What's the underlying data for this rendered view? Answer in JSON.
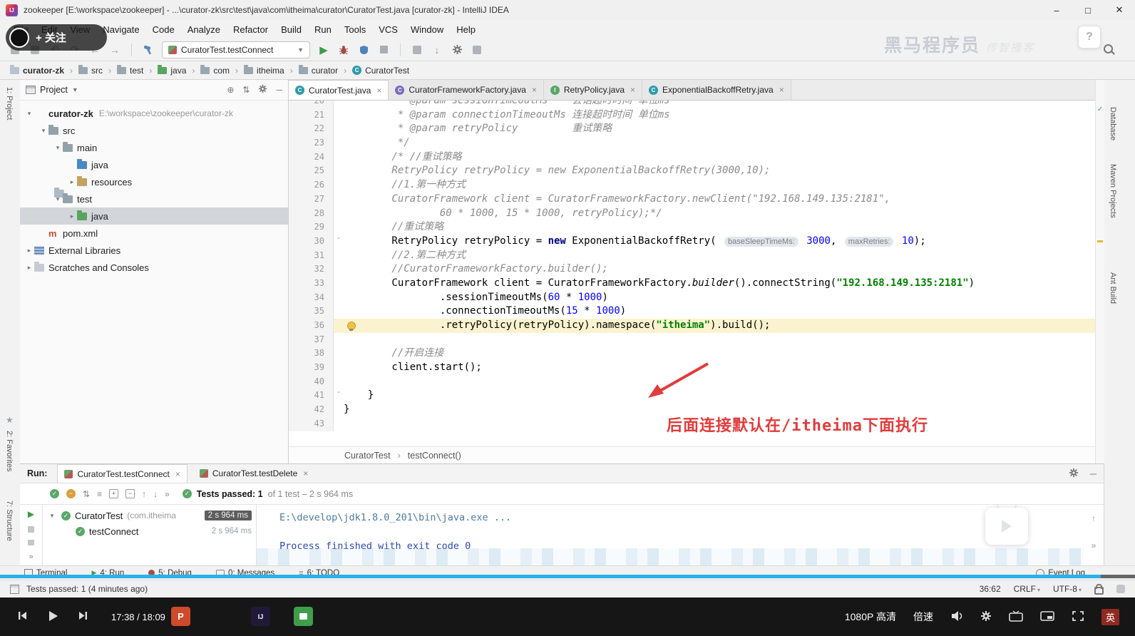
{
  "window": {
    "title": "zookeeper [E:\\workspace\\zookeeper] - ...\\curator-zk\\src\\test\\java\\com\\itheima\\curator\\CuratorTest.java [curator-zk] - IntelliJ IDEA",
    "minimize": "–",
    "maximize": "□",
    "close": "✕"
  },
  "menu": {
    "items": [
      "File",
      "Edit",
      "View",
      "Navigate",
      "Code",
      "Analyze",
      "Refactor",
      "Build",
      "Run",
      "Tools",
      "VCS",
      "Window",
      "Help"
    ]
  },
  "overlay": {
    "follow": "+ 关注",
    "watermark": "黑马程序员",
    "watermark_sub": "传智播客",
    "help": "?"
  },
  "toolbar": {
    "run_config": "CuratorTest.testConnect"
  },
  "breadcrumbs": {
    "items": [
      {
        "label": "curator-zk",
        "icon": "module",
        "bold": true
      },
      {
        "label": "src",
        "icon": "folder"
      },
      {
        "label": "test",
        "icon": "folder"
      },
      {
        "label": "java",
        "icon": "folder-green"
      },
      {
        "label": "com",
        "icon": "folder"
      },
      {
        "label": "itheima",
        "icon": "folder"
      },
      {
        "label": "curator",
        "icon": "folder"
      },
      {
        "label": "CuratorTest",
        "icon": "class"
      }
    ]
  },
  "stripes": {
    "left": [
      "1: Project",
      "2: Favorites",
      "7: Structure"
    ],
    "right": [
      "Database",
      "Maven Projects",
      "Ant Build"
    ]
  },
  "project_panel": {
    "header": "Project",
    "tree": [
      {
        "label": "curator-zk",
        "extra": "E:\\workspace\\zookeeper\\curator-zk",
        "depth": 0,
        "caret": "v",
        "icon": "project",
        "bold": true
      },
      {
        "label": "src",
        "depth": 1,
        "caret": "v",
        "icon": "folder"
      },
      {
        "label": "main",
        "depth": 2,
        "caret": "v",
        "icon": "folder"
      },
      {
        "label": "java",
        "depth": 3,
        "caret": "",
        "icon": "folder-blue"
      },
      {
        "label": "resources",
        "depth": 3,
        "caret": ">",
        "icon": "folder-res"
      },
      {
        "label": "test",
        "depth": 2,
        "caret": "v",
        "icon": "folder"
      },
      {
        "label": "java",
        "depth": 3,
        "caret": ">",
        "icon": "folder-green",
        "selected": true
      },
      {
        "label": "pom.xml",
        "depth": 1,
        "caret": "",
        "icon": "maven"
      },
      {
        "label": "External Libraries",
        "depth": 0,
        "caret": ">",
        "icon": "libs"
      },
      {
        "label": "Scratches and Consoles",
        "depth": 0,
        "caret": ">",
        "icon": "scratch"
      }
    ]
  },
  "editor": {
    "tabs": [
      {
        "label": "CuratorTest.java",
        "icon": "C",
        "color": "#2e9bab",
        "active": true
      },
      {
        "label": "CuratorFrameworkFactory.java",
        "icon": "C",
        "color": "#7d6cc0"
      },
      {
        "label": "RetryPolicy.java",
        "icon": "I",
        "color": "#59a869"
      },
      {
        "label": "ExponentialBackoffRetry.java",
        "icon": "C",
        "color": "#2e9bab"
      }
    ],
    "breadcrumb_bottom": {
      "class": "CuratorTest",
      "method": "testConnect()"
    },
    "annotation": "后面连接默认在/itheima下面执行",
    "lines": [
      {
        "n": 20,
        "segs": [
          [
            "c",
            "         * @param sessionTimeoutMs    会话超时时间 单位ms"
          ]
        ]
      },
      {
        "n": 21,
        "segs": [
          [
            "c",
            "         * @param connectionTimeoutMs 连接超时时间 单位ms"
          ]
        ]
      },
      {
        "n": 22,
        "segs": [
          [
            "c",
            "         * @param retryPolicy         重试策略"
          ]
        ]
      },
      {
        "n": 23,
        "segs": [
          [
            "c",
            "         */"
          ]
        ]
      },
      {
        "n": 24,
        "segs": [
          [
            "c",
            "        /* //重试策略"
          ]
        ]
      },
      {
        "n": 25,
        "segs": [
          [
            "c",
            "        RetryPolicy retryPolicy = new ExponentialBackoffRetry(3000,10);"
          ]
        ]
      },
      {
        "n": 26,
        "segs": [
          [
            "c",
            "        //1.第一种方式"
          ]
        ]
      },
      {
        "n": 27,
        "segs": [
          [
            "c",
            "        CuratorFramework client = CuratorFrameworkFactory.newClient(\"192.168.149.135:2181\","
          ]
        ]
      },
      {
        "n": 28,
        "segs": [
          [
            "c",
            "                60 * 1000, 15 * 1000, retryPolicy);*/"
          ]
        ]
      },
      {
        "n": 29,
        "segs": [
          [
            "c",
            "        //重试策略"
          ]
        ]
      },
      {
        "n": 30,
        "fold": "v",
        "segs": [
          [
            "p",
            "        RetryPolicy retryPolicy = "
          ],
          [
            "k",
            "new"
          ],
          [
            "p",
            " ExponentialBackoffRetry( "
          ],
          [
            "h",
            "baseSleepTimeMs:"
          ],
          [
            "n",
            " 3000"
          ],
          [
            "p",
            ", "
          ],
          [
            "h",
            "maxRetries:"
          ],
          [
            "n",
            " 10"
          ],
          [
            "p",
            ");"
          ]
        ]
      },
      {
        "n": 31,
        "segs": [
          [
            "c",
            "        //2.第二种方式"
          ]
        ]
      },
      {
        "n": 32,
        "segs": [
          [
            "c",
            "        //CuratorFrameworkFactory.builder();"
          ]
        ]
      },
      {
        "n": 33,
        "segs": [
          [
            "p",
            "        CuratorFramework client = CuratorFrameworkFactory."
          ],
          [
            "m",
            "builder"
          ],
          [
            "p",
            "().connectString("
          ],
          [
            "s",
            "\"192.168.149.135:2181\""
          ],
          [
            "p",
            ")"
          ]
        ]
      },
      {
        "n": 34,
        "segs": [
          [
            "p",
            "                .sessionTimeoutMs("
          ],
          [
            "n",
            "60"
          ],
          [
            "p",
            " * "
          ],
          [
            "n",
            "1000"
          ],
          [
            "p",
            ")"
          ]
        ]
      },
      {
        "n": 35,
        "segs": [
          [
            "p",
            "                .connectionTimeoutMs("
          ],
          [
            "n",
            "15"
          ],
          [
            "p",
            " * "
          ],
          [
            "n",
            "1000"
          ],
          [
            "p",
            ")"
          ]
        ]
      },
      {
        "n": 36,
        "hl": true,
        "segs": [
          [
            "p",
            "                .retryPolicy(retryPolicy).namespace("
          ],
          [
            "s",
            "\"itheima\""
          ],
          [
            "p",
            ").build();"
          ]
        ]
      },
      {
        "n": 37,
        "segs": []
      },
      {
        "n": 38,
        "segs": [
          [
            "c",
            "        //开启连接"
          ]
        ]
      },
      {
        "n": 39,
        "segs": [
          [
            "p",
            "        client.start();"
          ]
        ]
      },
      {
        "n": 40,
        "segs": []
      },
      {
        "n": 41,
        "fold": "^",
        "segs": [
          [
            "p",
            "    }"
          ]
        ]
      },
      {
        "n": 42,
        "segs": [
          [
            "p",
            "}"
          ]
        ]
      },
      {
        "n": 43,
        "segs": []
      }
    ]
  },
  "run_panel": {
    "label": "Run:",
    "tabs": [
      {
        "label": "CuratorTest.testConnect",
        "active": true
      },
      {
        "label": "CuratorTest.testDelete"
      }
    ],
    "status_bold": "Tests passed: 1",
    "status_rest": " of 1 test – 2 s 964 ms",
    "tree": [
      {
        "label": "CuratorTest",
        "extra": "(com.itheima.cu",
        "time": "2 s 964 ms",
        "chip": true,
        "caret": "v"
      },
      {
        "label": "testConnect",
        "time": "2 s 964 ms"
      }
    ],
    "console_line1": "E:\\develop\\jdk1.8.0_201\\bin\\java.exe ...",
    "console_line2": "Process finished with exit code 0"
  },
  "bottom_bar": {
    "items": [
      "Terminal",
      "4: Run",
      "5: Debug",
      "0: Messages",
      "6: TODO"
    ],
    "right": "Event Log"
  },
  "status_bar": {
    "left": "Tests passed: 1 (4 minutes ago)",
    "position": "36:62",
    "line_ending": "CRLF",
    "encoding": "UTF-8"
  },
  "player": {
    "time": "17:38 / 18:09",
    "quality": "1080P 高清",
    "speed": "倍速",
    "ime": "英",
    "app_ppt": "P",
    "app_idea": "IJ"
  }
}
